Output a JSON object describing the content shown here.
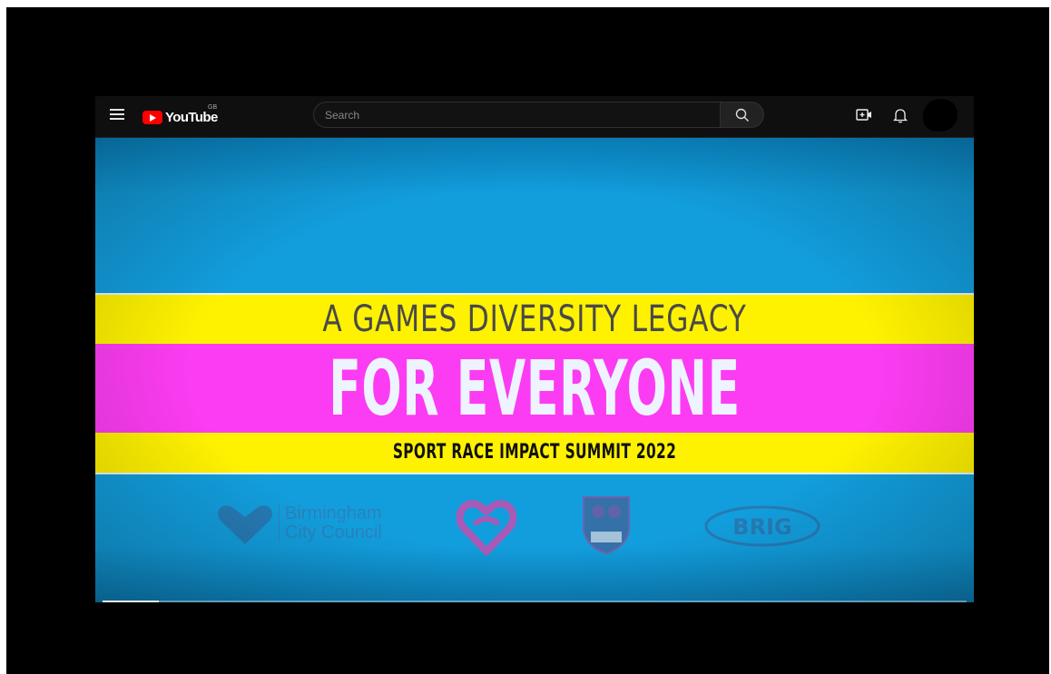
{
  "header": {
    "logo_text": "YouTube",
    "region": "GB",
    "search_placeholder": "Search",
    "icons": [
      "menu-icon",
      "youtube-logo-icon",
      "search-icon",
      "create-icon",
      "bell-icon",
      "avatar"
    ]
  },
  "video": {
    "headline": "A GAMES DIVERSITY LEGACY",
    "title": "FOR EVERYONE",
    "subtitle": "SPORT RACE IMPACT SUMMIT 2022",
    "sponsors": {
      "bcc_line1": "Birmingham",
      "bcc_line2": "City Council",
      "brig_text": "BRIG"
    },
    "progress_fraction": 0.065
  },
  "colors": {
    "sky": "#129ddc",
    "yellow": "#fff200",
    "pink": "#fc3cf2",
    "brand_red": "#ff0000"
  }
}
